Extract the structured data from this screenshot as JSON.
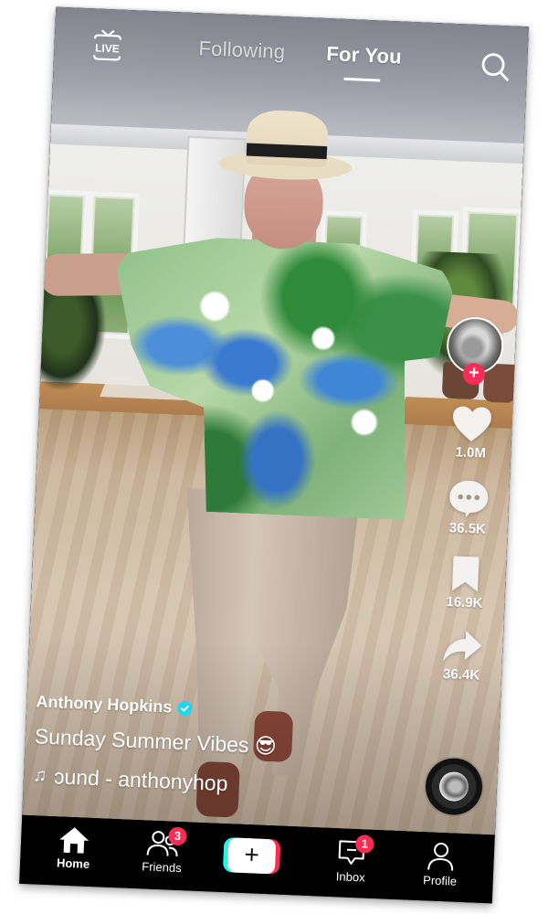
{
  "top_nav": {
    "live_label": "LIVE",
    "tabs": [
      {
        "label": "Following",
        "active": false
      },
      {
        "label": "For You",
        "active": true
      }
    ]
  },
  "video": {
    "author": "Anthony Hopkins",
    "verified": true,
    "description": "Sunday Summer Vibes 😎",
    "sound": "ɔund - anthonyhop"
  },
  "actions": {
    "follow_symbol": "+",
    "likes": "1.0M",
    "comments": "36.5K",
    "bookmarks": "16.9K",
    "shares": "36.4K"
  },
  "bottom_nav": {
    "items": [
      {
        "label": "Home",
        "icon": "home-icon",
        "active": true
      },
      {
        "label": "Friends",
        "icon": "friends-icon",
        "badge": "3"
      },
      {
        "label": "+",
        "icon": "create-icon"
      },
      {
        "label": "Inbox",
        "icon": "inbox-icon",
        "badge": "1"
      },
      {
        "label": "Profile",
        "icon": "profile-icon"
      }
    ]
  },
  "colors": {
    "accent_red": "#fe2c55",
    "accent_cyan": "#25f4ee",
    "verified_blue": "#20d5ec",
    "nav_background": "#000000"
  }
}
